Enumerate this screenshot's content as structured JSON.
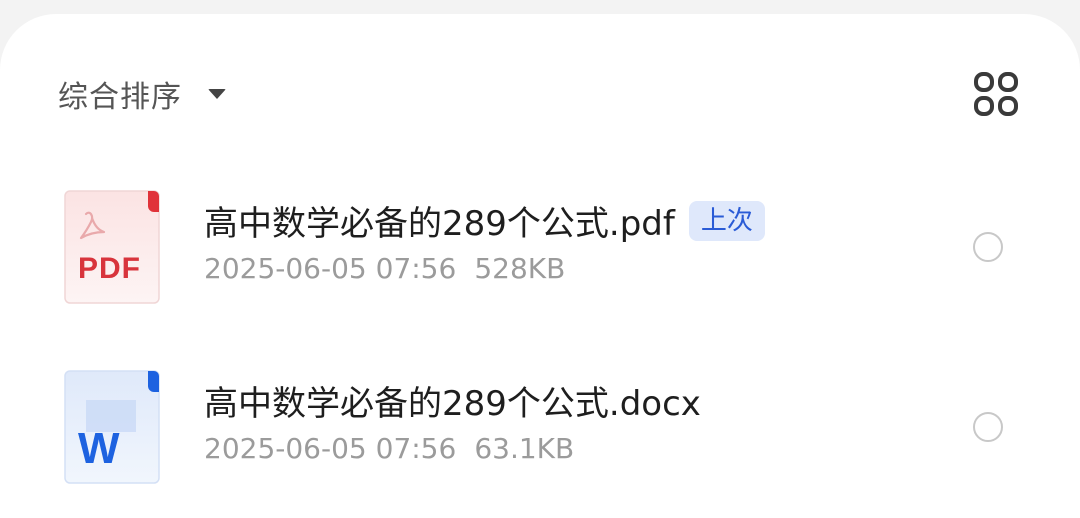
{
  "sort": {
    "label": "综合排序",
    "caret_icon": "caret-down-icon"
  },
  "view_toggle": {
    "icon": "grid-view-icon"
  },
  "files": [
    {
      "name": "高中数学必备的289个公式.pdf",
      "badge": "上次",
      "date": "2025-06-05 07:56",
      "size": "528KB",
      "type": "pdf",
      "icon_label": "PDF",
      "icon": "pdf-file-icon",
      "accent_color": "#e0323a",
      "selected": false
    },
    {
      "name": "高中数学必备的289个公式.docx",
      "badge": "",
      "date": "2025-06-05 07:56",
      "size": "63.1KB",
      "type": "docx",
      "icon_label": "W",
      "icon": "word-file-icon",
      "accent_color": "#1d62e0",
      "selected": false
    }
  ],
  "colors": {
    "badge_bg": "#dfe8fb",
    "badge_text": "#2a5bd6",
    "meta_text": "#9b9b9b"
  }
}
